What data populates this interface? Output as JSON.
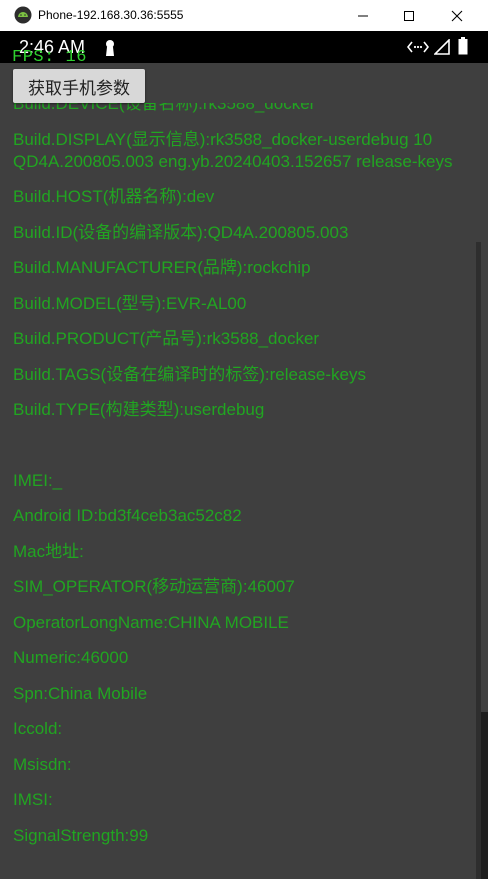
{
  "window": {
    "title": "Phone-192.168.30.36:5555",
    "minimize_icon": "minimize-icon",
    "maximize_icon": "maximize-icon",
    "close_icon": "close-icon"
  },
  "statusbar": {
    "time": "2:46 AM",
    "icons": [
      "notification-icon",
      "vpn-icon",
      "signal-icon",
      "battery-icon"
    ]
  },
  "overlay": {
    "fps": "FPS: 16"
  },
  "actions": {
    "get_params_label": "获取手机参数"
  },
  "info": {
    "hidden_top": "Build.DEVICE(设备名称):rk3588_docker",
    "display": "Build.DISPLAY(显示信息):rk3588_docker-userdebug 10 QD4A.200805.003 eng.yb.20240403.152657 release-keys",
    "host": "Build.HOST(机器名称):dev",
    "id": "Build.ID(设备的编译版本):QD4A.200805.003",
    "manufacturer": "Build.MANUFACTURER(品牌):rockchip",
    "model": "Build.MODEL(型号):EVR-AL00",
    "product": "Build.PRODUCT(产品号):rk3588_docker",
    "tags": "Build.TAGS(设备在编译时的标签):release-keys",
    "type": "Build.TYPE(构建类型):userdebug",
    "imei": "IMEI:_",
    "android_id": "Android ID:bd3f4ceb3ac52c82",
    "mac": "Mac地址:",
    "sim_operator": "SIM_OPERATOR(移动运营商):46007",
    "operator_long_name": "OperatorLongName:CHINA MOBILE",
    "numeric": "Numeric:46000",
    "spn": "Spn:China Mobile",
    "iccid": "Iccold:",
    "msisdn": "Msisdn:",
    "imsi": "IMSI:",
    "signal_strength": "SignalStrength:99"
  },
  "colors": {
    "info_text": "#21a521",
    "fps_text": "#2fd22f",
    "background": "#3f3f3f",
    "statusbar": "#000000"
  }
}
